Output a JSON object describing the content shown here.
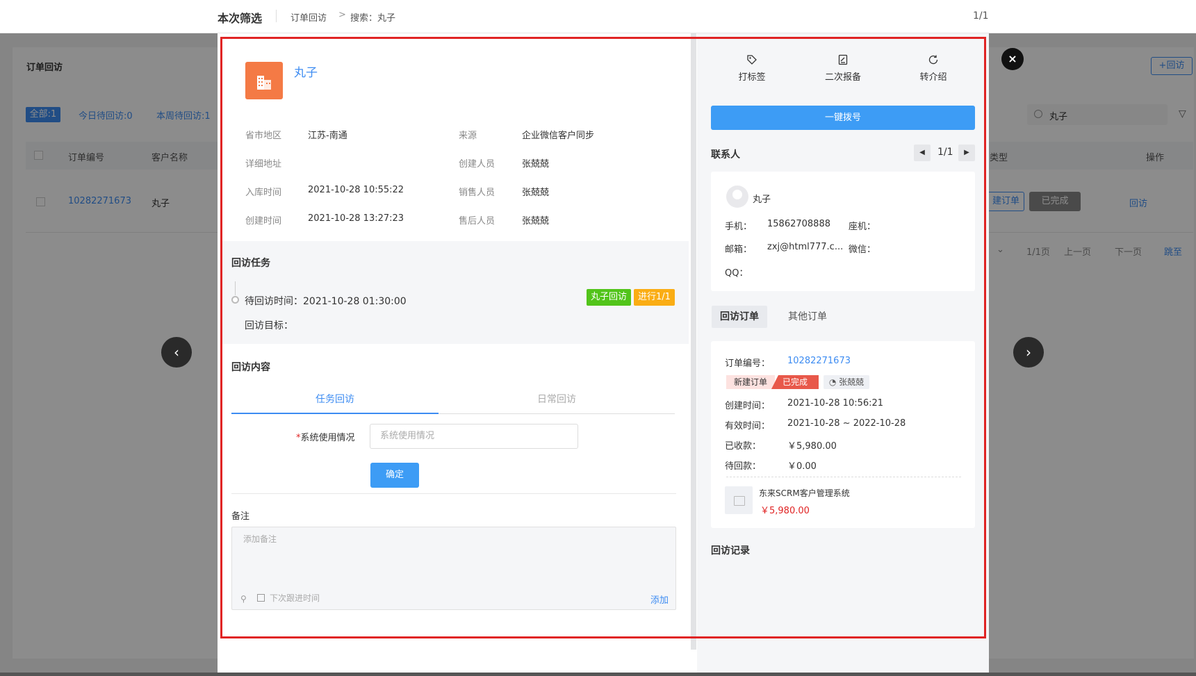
{
  "topbar": {
    "title": "本次筛选",
    "breadcrumb_1": "订单回访",
    "breadcrumb_arrow": ">",
    "breadcrumb_2": "搜索：丸子",
    "page_count": "1/1"
  },
  "background_page": {
    "title": "订单回访",
    "add_button": "+回访",
    "chips": {
      "all": "全部:1",
      "today": "今日待回访:0",
      "week": "本周待回访:1"
    },
    "search_value": "丸子",
    "columns": {
      "order_no": "订单编号",
      "customer": "客户名称",
      "type": "类型",
      "action": "操作"
    },
    "row": {
      "order_no": "10282271673",
      "customer": "丸子",
      "new_order": "建订单",
      "done": "已完成",
      "visit": "回访"
    },
    "pager": {
      "pages": "1/1页",
      "prev": "上一页",
      "next": "下一页",
      "jump": "跳至"
    }
  },
  "modal": {
    "close_icon": "×",
    "prev_icon": "‹",
    "next_icon": "›",
    "customer": {
      "name": "丸子",
      "fields": [
        {
          "label": "省市地区",
          "value": "江苏-南通"
        },
        {
          "label": "来源",
          "value": "企业微信客户同步"
        },
        {
          "label": "详细地址",
          "value": ""
        },
        {
          "label": "创建人员",
          "value": "张兢兢"
        },
        {
          "label": "入库时间",
          "value": "2021-10-28 10:55:22"
        },
        {
          "label": "销售人员",
          "value": "张兢兢"
        },
        {
          "label": "创建时间",
          "value": "2021-10-28 13:27:23"
        },
        {
          "label": "售后人员",
          "value": "张兢兢"
        }
      ]
    },
    "task": {
      "title": "回访任务",
      "time": "待回访时间：2021-10-28 01:30:00",
      "goal": "回访目标：",
      "tag_visit": "丸子回访",
      "tag_progress": "进行1/1"
    },
    "content": {
      "title": "回访内容",
      "tab_task": "任务回访",
      "tab_daily": "日常回访",
      "required_mark": "*",
      "field_label": "系统使用情况",
      "field_placeholder": "系统使用情况",
      "confirm": "确定"
    },
    "note": {
      "label": "备注",
      "placeholder": "添加备注",
      "next_time": "下次跟进时间",
      "add": "添加"
    },
    "actions": {
      "tag": "打标签",
      "report": "二次报备",
      "refer": "转介绍",
      "dial": "一键拨号"
    },
    "contact": {
      "title": "联系人",
      "pager": "1/1",
      "name": "丸子",
      "mobile_label": "手机：",
      "mobile": "15862708888",
      "phone_label": "座机：",
      "email_label": "邮箱：",
      "email": "zxj@html777.c...",
      "wechat_label": "微信：",
      "qq_label": "QQ："
    },
    "orders": {
      "tab_visit": "回访订单",
      "tab_other": "其他订单",
      "order_no_label": "订单编号：",
      "order_no": "10282271673",
      "badge_new": "新建订单",
      "badge_done": "已完成",
      "badge_user": "张兢兢",
      "created_label": "创建时间：",
      "created": "2021-10-28 10:56:21",
      "valid_label": "有效时间：",
      "valid": "2021-10-28 ~ 2022-10-28",
      "received_label": "已收款：",
      "received": "￥5,980.00",
      "pending_label": "待回款：",
      "pending": "￥0.00",
      "product_name": "东来SCRM客户管理系统",
      "product_price": "￥5,980.00"
    },
    "records_title": "回访记录"
  }
}
